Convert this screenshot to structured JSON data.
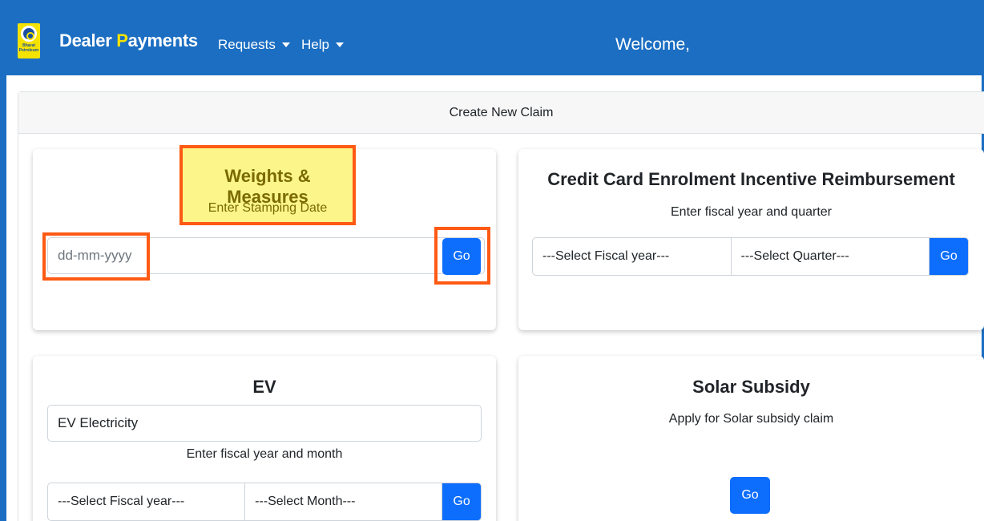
{
  "navbar": {
    "brand_part1": "Dealer ",
    "brand_p": "P",
    "brand_part2": "ayments",
    "logo_text": "Bharat Petroleum",
    "menu": [
      {
        "label": "Requests"
      },
      {
        "label": "Help"
      }
    ],
    "welcome": "Welcome,"
  },
  "page": {
    "header": "Create New Claim"
  },
  "cards": {
    "weights": {
      "title": "Weights & Measures",
      "subtitle": "Enter Stamping Date",
      "date_placeholder": "dd-mm-yyyy",
      "go_label": "Go"
    },
    "credit_card": {
      "title": "Credit Card Enrolment Incentive Reimbursement",
      "subtitle": "Enter fiscal year and quarter",
      "fiscal_year_select": "---Select Fiscal year---",
      "quarter_select": "---Select Quarter---",
      "go_label": "Go"
    },
    "ev": {
      "title": "EV",
      "type_value": "EV Electricity",
      "subtitle": "Enter fiscal year and month",
      "fiscal_year_select": "---Select Fiscal year---",
      "month_select": "---Select Month---",
      "go_label": "Go"
    },
    "solar": {
      "title": "Solar Subsidy",
      "subtitle": "Apply for Solar subsidy claim",
      "go_label": "Go"
    }
  },
  "colors": {
    "navbar": "#1b6ec2",
    "primary_button": "#0d6efd",
    "highlight_border": "#ff5a14",
    "highlight_fill": "#fbf58a"
  }
}
